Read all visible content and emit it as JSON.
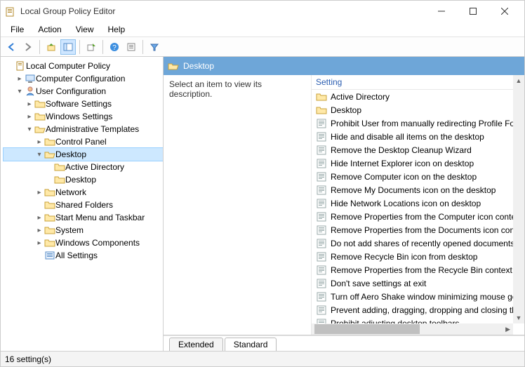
{
  "window": {
    "title": "Local Group Policy Editor"
  },
  "menu": {
    "file": "File",
    "action": "Action",
    "view": "View",
    "help": "Help"
  },
  "tree": {
    "root": "Local Computer Policy",
    "computer_config": "Computer Configuration",
    "user_config": "User Configuration",
    "software_settings": "Software Settings",
    "windows_settings": "Windows Settings",
    "admin_templates": "Administrative Templates",
    "control_panel": "Control Panel",
    "desktop": "Desktop",
    "active_directory": "Active Directory",
    "desktop_sub": "Desktop",
    "network": "Network",
    "shared_folders": "Shared Folders",
    "start_menu": "Start Menu and Taskbar",
    "system": "System",
    "windows_components": "Windows Components",
    "all_settings": "All Settings"
  },
  "right": {
    "header": "Desktop",
    "placeholder": "Select an item to view its description.",
    "column": "Setting",
    "items": [
      "Active Directory",
      "Desktop",
      "Prohibit User from manually redirecting Profile Fol",
      "Hide and disable all items on the desktop",
      "Remove the Desktop Cleanup Wizard",
      "Hide Internet Explorer icon on desktop",
      "Remove Computer icon on the desktop",
      "Remove My Documents icon on the desktop",
      "Hide Network Locations icon on desktop",
      "Remove Properties from the Computer icon conte",
      "Remove Properties from the Documents icon cont",
      "Do not add shares of recently opened documents t",
      "Remove Recycle Bin icon from desktop",
      "Remove Properties from the Recycle Bin context m",
      "Don't save settings at exit",
      "Turn off Aero Shake window minimizing mouse ge",
      "Prevent adding, dragging, dropping and closing th",
      "Prohibit adjusting desktop toolbars"
    ]
  },
  "tabs": {
    "extended": "Extended",
    "standard": "Standard"
  },
  "status": {
    "count": "16 setting(s)"
  }
}
